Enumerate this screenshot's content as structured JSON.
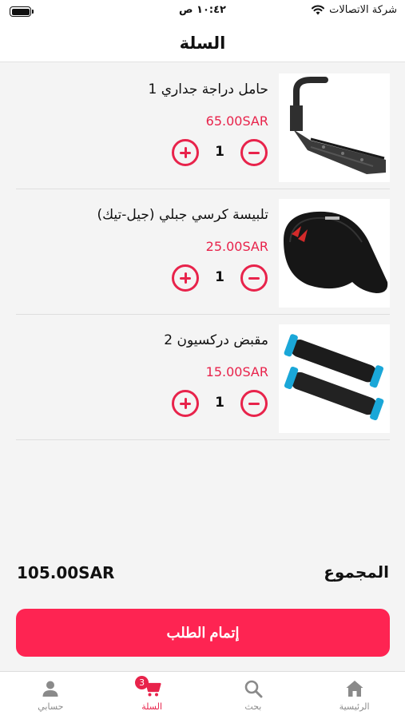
{
  "status_bar": {
    "carrier": "شركة الاتصالات",
    "time": "١٠:٤٢ ص"
  },
  "header": {
    "title": "السلة"
  },
  "cart": {
    "items": [
      {
        "name": "حامل دراجة جداري 1",
        "price": "65.00SAR",
        "quantity": "1",
        "image_icon": "wall-bike-hanger-image"
      },
      {
        "name": "تلبيسة كرسي جبلي  (جيل-تيك)",
        "price": "25.00SAR",
        "quantity": "1",
        "image_icon": "gel-seat-cover-image"
      },
      {
        "name": "مقبض دركسيون 2",
        "price": "15.00SAR",
        "quantity": "1",
        "image_icon": "handlebar-grips-image"
      }
    ]
  },
  "summary": {
    "total_label": "المجموع",
    "total_value": "105.00SAR",
    "checkout_label": "إتمام الطلب"
  },
  "tabs": [
    {
      "label": "حسابي",
      "icon": "user-icon"
    },
    {
      "label": "السلة",
      "icon": "cart-icon",
      "badge": "3",
      "active": true
    },
    {
      "label": "بحث",
      "icon": "search-icon"
    },
    {
      "label": "الرئيسية",
      "icon": "home-icon"
    }
  ],
  "colors": {
    "accent": "#e8234b",
    "button": "#fe2452",
    "background": "#f4f4f4",
    "tab_inactive": "#8a8a8a"
  }
}
